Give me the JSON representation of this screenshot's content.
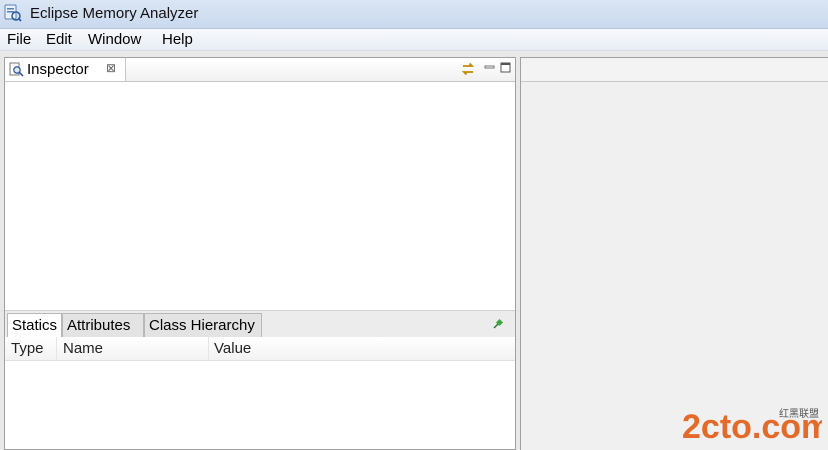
{
  "window": {
    "title": "Eclipse Memory Analyzer",
    "icon": "memory-analyzer-icon"
  },
  "menu": {
    "items": [
      "File",
      "Edit",
      "Window",
      "Help"
    ]
  },
  "inspector": {
    "tab_label": "Inspector",
    "close_glyph": "⊠",
    "tabs": [
      "Statics",
      "Attributes",
      "Class Hierarchy"
    ],
    "active_tab": "Statics",
    "columns": [
      "Type",
      "Name",
      "Value"
    ]
  },
  "watermark": {
    "text": "2cto.com",
    "sub": "红黑联盟"
  },
  "colors": {
    "accent": "#e46a2a",
    "title_bg": "#c9d9ee"
  }
}
